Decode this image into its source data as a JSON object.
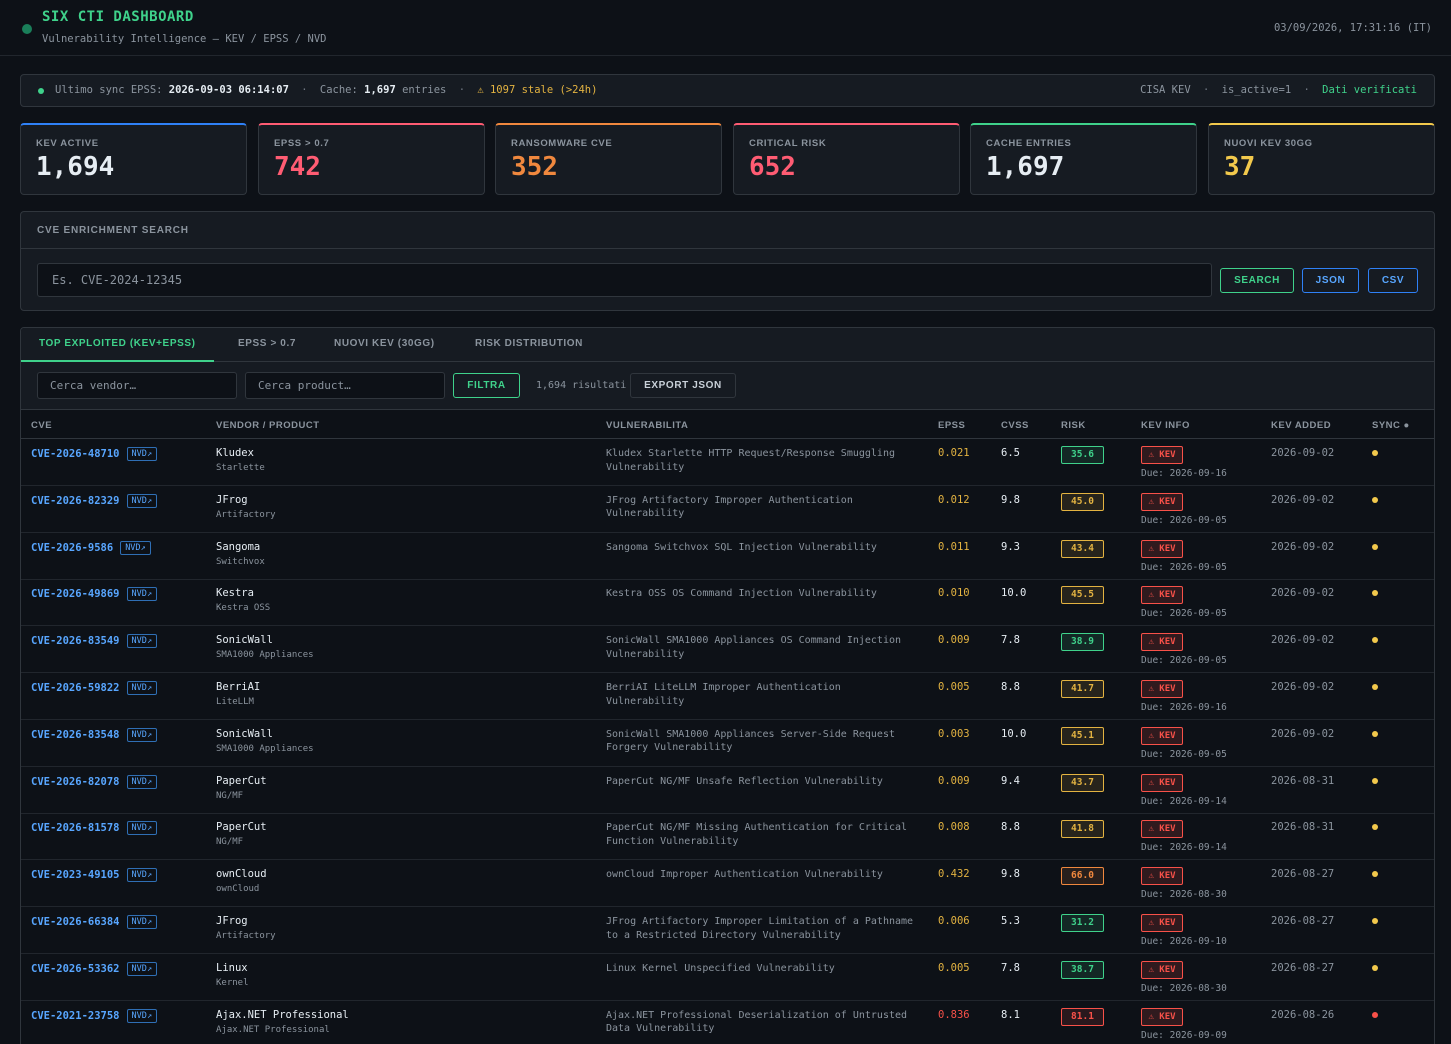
{
  "header": {
    "title": "SIX CTI DASHBOARD",
    "subtitle": "Vulnerability Intelligence — KEV / EPSS / NVD",
    "clock": "03/09/2026, 17:31:16 (IT)"
  },
  "sync": {
    "label": "Ultimo sync EPSS:",
    "date": "2026-09-03 06:14:07",
    "sep": "·",
    "cache_label": "Cache:",
    "cache_count": "1,697",
    "cache_unit": "entries",
    "stale": "⚠ 1097 stale (>24h)",
    "source": "CISA KEV",
    "filter": "is_active=1",
    "verified": "Dati verificati"
  },
  "stats": [
    {
      "label": "KEV ACTIVE",
      "value": "1,694",
      "color": "#e6edf3",
      "accent": "#2f81f7"
    },
    {
      "label": "EPSS > 0.7",
      "value": "742",
      "color": "#ff5c73",
      "accent": "#ff5c73"
    },
    {
      "label": "RANSOMWARE CVE",
      "value": "352",
      "color": "#f0883e",
      "accent": "#f0883e"
    },
    {
      "label": "CRITICAL RISK",
      "value": "652",
      "color": "#ff5c73",
      "accent": "#ff5c73"
    },
    {
      "label": "CACHE ENTRIES",
      "value": "1,697",
      "color": "#e6edf3",
      "accent": "#3fd28b"
    },
    {
      "label": "NUOVI KEV 30GG",
      "value": "37",
      "color": "#f2c94c",
      "accent": "#f2c94c"
    }
  ],
  "search": {
    "title": "CVE ENRICHMENT SEARCH",
    "placeholder": "Es. CVE-2024-12345",
    "search_label": "SEARCH",
    "json_label": "JSON",
    "csv_label": "CSV"
  },
  "tabs": [
    "TOP EXPLOITED (KEV+EPSS)",
    "EPSS > 0.7",
    "NUOVI KEV (30GG)",
    "RISK DISTRIBUTION"
  ],
  "filters": {
    "vendor_placeholder": "Cerca vendor…",
    "product_placeholder": "Cerca product…",
    "filter_label": "FILTRA",
    "results": "1,694 risultati",
    "export_label": "EXPORT JSON"
  },
  "table": {
    "columns": [
      "CVE",
      "VENDOR / PRODUCT",
      "VULNERABILITA",
      "EPSS",
      "CVSS",
      "RISK",
      "KEV INFO",
      "KEV ADDED",
      "SYNC ●"
    ],
    "nvd_label": "NVD↗",
    "kev_label": "⚠ KEV",
    "rows": [
      {
        "cve": "CVE-2026-48710",
        "vendor": "Kludex",
        "product": "Starlette",
        "vuln": "Kludex Starlette HTTP Request/Response Smuggling Vulnerability",
        "epss": "0.021",
        "epss_color": "#e3b341",
        "cvss": "6.5",
        "risk": "35.6",
        "risk_level": "green",
        "due": "Due: 2026-09-16",
        "added": "2026-09-02",
        "sync_color": "#f2c94c"
      },
      {
        "cve": "CVE-2026-82329",
        "vendor": "JFrog",
        "product": "Artifactory",
        "vuln": "JFrog Artifactory Improper Authentication Vulnerability",
        "epss": "0.012",
        "epss_color": "#e3b341",
        "cvss": "9.8",
        "risk": "45.0",
        "risk_level": "yellow",
        "due": "Due: 2026-09-05",
        "added": "2026-09-02",
        "sync_color": "#f2c94c"
      },
      {
        "cve": "CVE-2026-9586",
        "vendor": "Sangoma",
        "product": "Switchvox",
        "vuln": "Sangoma Switchvox SQL Injection Vulnerability",
        "epss": "0.011",
        "epss_color": "#e3b341",
        "cvss": "9.3",
        "risk": "43.4",
        "risk_level": "yellow",
        "due": "Due: 2026-09-05",
        "added": "2026-09-02",
        "sync_color": "#f2c94c"
      },
      {
        "cve": "CVE-2026-49869",
        "vendor": "Kestra",
        "product": "Kestra OSS",
        "vuln": "Kestra OSS OS Command Injection Vulnerability",
        "epss": "0.010",
        "epss_color": "#e3b341",
        "cvss": "10.0",
        "risk": "45.5",
        "risk_level": "yellow",
        "due": "Due: 2026-09-05",
        "added": "2026-09-02",
        "sync_color": "#f2c94c"
      },
      {
        "cve": "CVE-2026-83549",
        "vendor": "SonicWall",
        "product": "SMA1000 Appliances",
        "vuln": "SonicWall SMA1000 Appliances OS Command Injection Vulnerability",
        "epss": "0.009",
        "epss_color": "#e3b341",
        "cvss": "7.8",
        "risk": "38.9",
        "risk_level": "green",
        "due": "Due: 2026-09-05",
        "added": "2026-09-02",
        "sync_color": "#f2c94c"
      },
      {
        "cve": "CVE-2026-59822",
        "vendor": "BerriAI",
        "product": "LiteLLM",
        "vuln": "BerriAI LiteLLM Improper Authentication Vulnerability",
        "epss": "0.005",
        "epss_color": "#e3b341",
        "cvss": "8.8",
        "risk": "41.7",
        "risk_level": "yellow",
        "due": "Due: 2026-09-16",
        "added": "2026-09-02",
        "sync_color": "#f2c94c"
      },
      {
        "cve": "CVE-2026-83548",
        "vendor": "SonicWall",
        "product": "SMA1000 Appliances",
        "vuln": "SonicWall SMA1000 Appliances Server-Side Request Forgery Vulnerability",
        "epss": "0.003",
        "epss_color": "#e3b341",
        "cvss": "10.0",
        "risk": "45.1",
        "risk_level": "yellow",
        "due": "Due: 2026-09-05",
        "added": "2026-09-02",
        "sync_color": "#f2c94c"
      },
      {
        "cve": "CVE-2026-82078",
        "vendor": "PaperCut",
        "product": "NG/MF",
        "vuln": "PaperCut NG/MF Unsafe Reflection Vulnerability",
        "epss": "0.009",
        "epss_color": "#e3b341",
        "cvss": "9.4",
        "risk": "43.7",
        "risk_level": "yellow",
        "due": "Due: 2026-09-14",
        "added": "2026-08-31",
        "sync_color": "#f2c94c"
      },
      {
        "cve": "CVE-2026-81578",
        "vendor": "PaperCut",
        "product": "NG/MF",
        "vuln": "PaperCut NG/MF Missing Authentication for Critical Function Vulnerability",
        "epss": "0.008",
        "epss_color": "#e3b341",
        "cvss": "8.8",
        "risk": "41.8",
        "risk_level": "yellow",
        "due": "Due: 2026-09-14",
        "added": "2026-08-31",
        "sync_color": "#f2c94c"
      },
      {
        "cve": "CVE-2023-49105",
        "vendor": "ownCloud",
        "product": "ownCloud",
        "vuln": "ownCloud Improper Authentication Vulnerability",
        "epss": "0.432",
        "epss_color": "#e3b341",
        "cvss": "9.8",
        "risk": "66.0",
        "risk_level": "orange",
        "due": "Due: 2026-08-30",
        "added": "2026-08-27",
        "sync_color": "#f2c94c"
      },
      {
        "cve": "CVE-2026-66384",
        "vendor": "JFrog",
        "product": "Artifactory",
        "vuln": "JFrog Artifactory Improper Limitation of a Pathname to a Restricted Directory Vulnerability",
        "epss": "0.006",
        "epss_color": "#e3b341",
        "cvss": "5.3",
        "risk": "31.2",
        "risk_level": "green",
        "due": "Due: 2026-09-10",
        "added": "2026-08-27",
        "sync_color": "#f2c94c"
      },
      {
        "cve": "CVE-2026-53362",
        "vendor": "Linux",
        "product": "Kernel",
        "vuln": "Linux Kernel Unspecified Vulnerability",
        "epss": "0.005",
        "epss_color": "#e3b341",
        "cvss": "7.8",
        "risk": "38.7",
        "risk_level": "green",
        "due": "Due: 2026-08-30",
        "added": "2026-08-27",
        "sync_color": "#f2c94c"
      },
      {
        "cve": "CVE-2021-23758",
        "vendor": "Ajax.NET Professional",
        "product": "Ajax.NET Professional",
        "vuln": "Ajax.NET Professional Deserialization of Untrusted Data Vulnerability",
        "epss": "0.836",
        "epss_color": "#f85149",
        "cvss": "8.1",
        "risk": "81.1",
        "risk_level": "red",
        "due": "Due: 2026-09-09",
        "added": "2026-08-26",
        "sync_color": "#f85149"
      }
    ]
  }
}
